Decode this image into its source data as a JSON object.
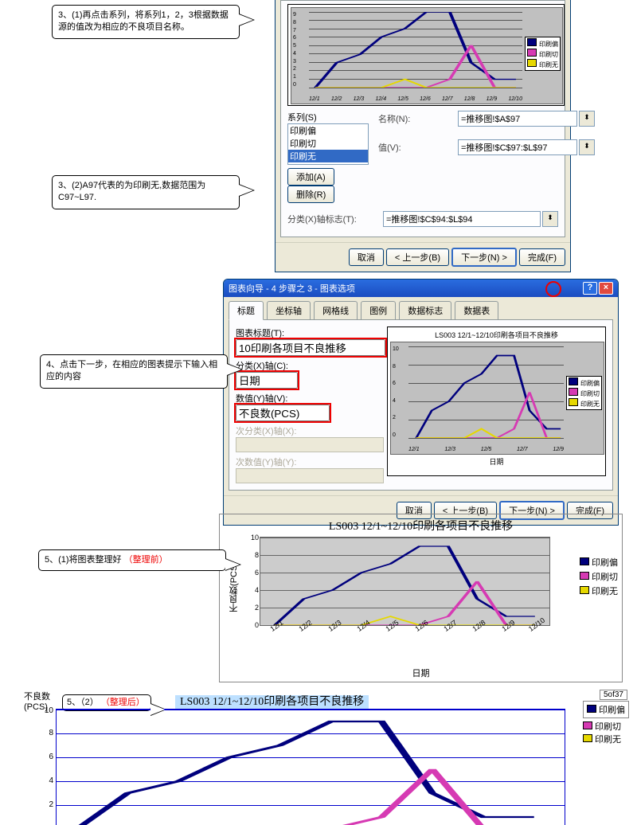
{
  "callouts": {
    "c3_1": "3、(1)再点击系列，将系列1，2，3根据数据源的值改为相应的不良项目名称。",
    "c3_2": "3、(2)A97代表的为印刷无,数据范围为C97~L97.",
    "c4": "4、点击下一步，在相应的图表提示下输入相应的内容",
    "c5_1_a": "5、(1)将图表整理好",
    "c5_1_b": "（整理前）",
    "c5_2_a": "5、（2）",
    "c5_2_b": "（整理后）"
  },
  "dialog1": {
    "series_label": "系列(S)",
    "series_items": [
      "印刷偏",
      "印刷切",
      "印刷无"
    ],
    "name_label": "名称(N):",
    "name_value": "=推移图!$A$97",
    "value_label": "值(V):",
    "value_value": "=推移图!$C$97:$L$97",
    "catx_label": "分类(X)轴标志(T):",
    "catx_value": "=推移图!$C$94:$L$94",
    "add_btn": "添加(A)",
    "remove_btn": "删除(R)",
    "btn_cancel": "取消",
    "btn_back": "< 上一步(B)",
    "btn_next": "下一步(N) >",
    "btn_finish": "完成(F)"
  },
  "dialog2": {
    "title": "图表向导 - 4 步骤之 3 - 图表选项",
    "tabs": [
      "标题",
      "坐标轴",
      "网格线",
      "图例",
      "数据标志",
      "数据表"
    ],
    "chart_title_label": "图表标题(T):",
    "chart_title_value": "10印刷各项目不良推移",
    "catx_label": "分类(X)轴(C):",
    "catx_value": "日期",
    "valy_label": "数值(Y)轴(V):",
    "valy_value": "不良数(PCS)",
    "secx_label": "次分类(X)轴(X):",
    "secy_label": "次数值(Y)轴(Y):",
    "preview_title": "LS003 12/1~12/10印刷各项目不良推移",
    "preview_xlabel": "日期",
    "btn_cancel": "取消",
    "btn_back": "< 上一步(B)",
    "btn_next": "下一步(N) >",
    "btn_finish": "完成(F)"
  },
  "chart_mid": {
    "title": "LS003 12/1~12/10印刷各项目不良推移",
    "ylabel": "不良数(PCS)",
    "xlabel": "日期"
  },
  "chart_bottom": {
    "title": "LS003  12/1~12/10印刷各项目不良推移",
    "ylabel": "不良数",
    "yunit": "(PCS)"
  },
  "legend_items": [
    "印刷偏",
    "印刷切",
    "印刷无"
  ],
  "page_badge": "5of37",
  "chart_data": {
    "type": "line",
    "categories": [
      "12/1",
      "12/2",
      "12/3",
      "12/4",
      "12/5",
      "12/6",
      "12/7",
      "12/8",
      "12/9",
      "12/10"
    ],
    "series": [
      {
        "name": "印刷偏",
        "values": [
          0,
          3,
          4,
          6,
          7,
          9,
          9,
          3,
          1,
          1
        ]
      },
      {
        "name": "印刷切",
        "values": [
          0,
          0,
          0,
          0,
          0,
          0,
          1,
          5,
          0,
          0
        ]
      },
      {
        "name": "印刷无",
        "values": [
          0,
          0,
          0,
          0,
          1,
          0,
          0,
          0,
          0,
          0
        ]
      }
    ],
    "ylim": [
      0,
      10
    ],
    "xlabel": "日期",
    "ylabel": "不良数(PCS)",
    "title": "LS003 12/1~12/10印刷各项目不良推移"
  }
}
